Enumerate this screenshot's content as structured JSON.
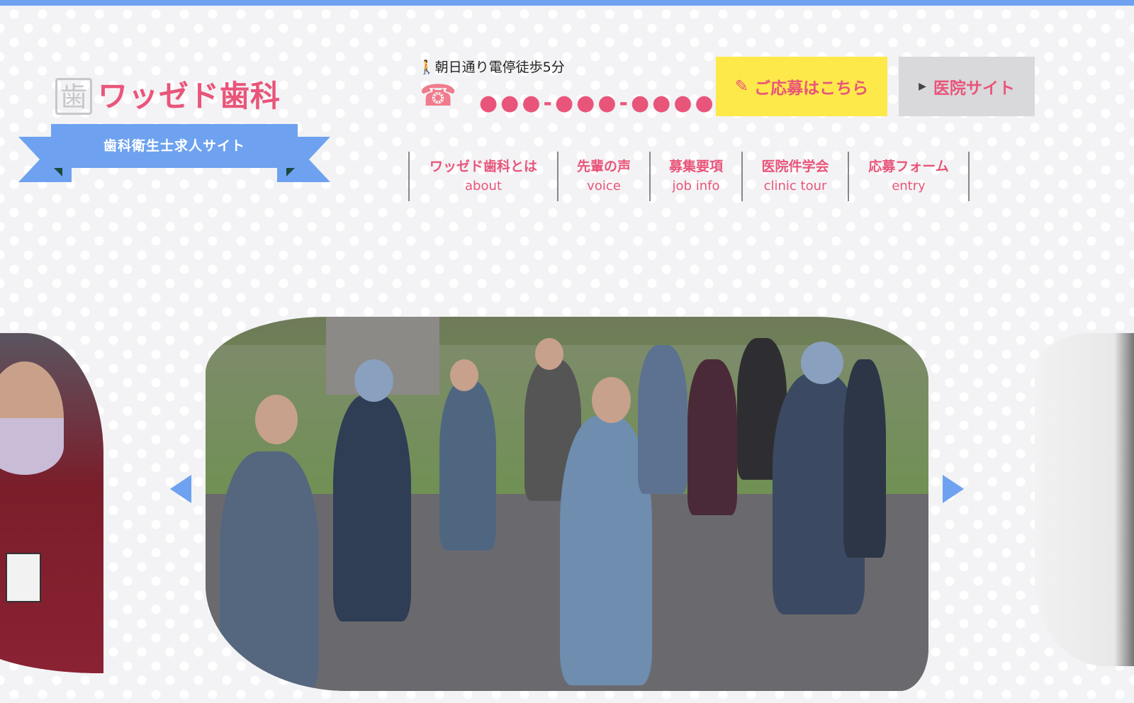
{
  "header": {
    "logo_mark": "歯",
    "logo_text": "ワッゼド歯科",
    "ribbon_text": "歯科衛生士求人サイト",
    "access_icon": "walking-person-icon",
    "access_text": "朝日通り電停徒歩5分",
    "phone_icon": "telephone-icon",
    "phone_number": "●●●-●●●-●●●●",
    "apply_icon": "edit-icon",
    "apply_label": "ご応募はこちら",
    "clinic_label": "医院サイト"
  },
  "nav": {
    "items": [
      {
        "jp": "ワッゼド歯科とは",
        "en": "about"
      },
      {
        "jp": "先輩の声",
        "en": "voice"
      },
      {
        "jp": "募集要項",
        "en": "job info"
      },
      {
        "jp": "医院件学会",
        "en": "clinic tour"
      },
      {
        "jp": "応募フォーム",
        "en": "entry"
      }
    ]
  },
  "colors": {
    "accent_pink": "#e9557a",
    "accent_blue": "#6ea2f0",
    "apply_yellow": "#fde94a",
    "clinic_gray": "#d9d9db"
  },
  "slider": {
    "prev_icon": "arrow-left-icon",
    "next_icon": "arrow-right-icon"
  }
}
